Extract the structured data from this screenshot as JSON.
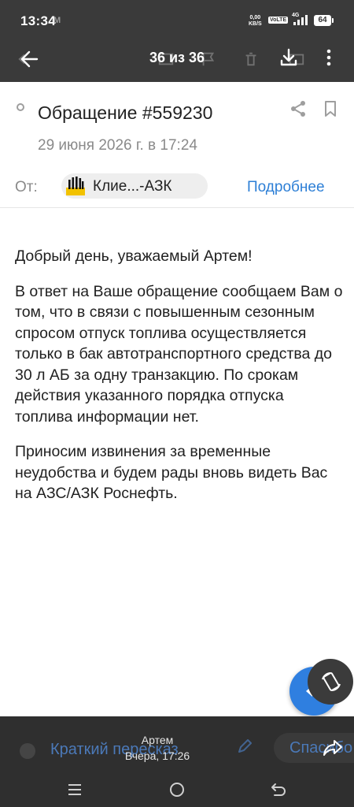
{
  "status_bar": {
    "time": "13:34",
    "carrier_mark": "M",
    "net_speed": "0,00",
    "net_unit": "KB/S",
    "volte": "VoLTE",
    "network_type": "4G",
    "battery": "64"
  },
  "toolbar": {
    "counter": "36 из 36",
    "icons": [
      "arrow-back-icon",
      "download-icon",
      "more-vertical-icon"
    ]
  },
  "email": {
    "subject": "Обращение #559230",
    "date": "29 июня 2026 г. в 17:24",
    "from_label": "От:",
    "sender": "Клие...-АЗК",
    "details_link": "Подробнее",
    "body": [
      "Добрый день, уважаемый Артем!",
      "В ответ на Ваше обращение сообщаем Вам о том, что в связи с повышенным сезонным спросом отпуск топлива осуществляется только в бак автотранспортного средства до 30 л АБ за одну транзакцию. По срокам действия указанного порядка отпуска топлива информации нет.",
      "Приносим извинения за временные неудобства и будем рады вновь видеть Вас на АЗС/АЗК Роснефть."
    ]
  },
  "bottom_panel": {
    "summary_button": "Краткий пересказ",
    "reply_sender": "Артем",
    "reply_time": "Вчера, 17:26",
    "thanks_button": "Спасибо"
  },
  "colors": {
    "header_bg": "#3a3a3a",
    "link": "#2d7fd6",
    "fab": "#2f7fe0",
    "panel_bg": "#2f2f2f"
  }
}
